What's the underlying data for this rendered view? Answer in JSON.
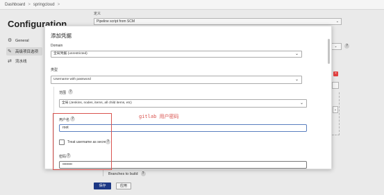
{
  "breadcrumb": {
    "items": [
      "Dashboard",
      "springcloud"
    ],
    "separator": ">"
  },
  "background": {
    "title": "Configuration",
    "sidebar": [
      {
        "label": "General",
        "icon": "gear-icon",
        "glyph": "⚙"
      },
      {
        "label": "高级项目选项",
        "icon": "wrench-icon",
        "glyph": "🔧"
      },
      {
        "label": "流水线",
        "icon": "pipeline-icon",
        "glyph": "⇄"
      }
    ],
    "definition_label": "定义",
    "definition_value": "Pipeline script from SCM",
    "branches_label": "Branches to build",
    "save_label": "保存",
    "apply_label": "应用"
  },
  "modal": {
    "title": "添加凭据",
    "domain_label": "Domain",
    "domain_value": "全局凭据 (unrestricted)",
    "kind_label": "类型",
    "kind_value": "Username with password",
    "scope_label": "范围",
    "scope_value": "全局 (Jenkins, nodes, items, all child items, etc)",
    "username_label": "用户名",
    "username_value": "root",
    "treat_secret_label": "Treat username as secret",
    "password_label": "密码",
    "password_value": "••••••••"
  },
  "annotation": {
    "text": "gitlab 用户密码",
    "color": "#d9534f"
  },
  "colors": {
    "primary_button": "#1e3a8a",
    "annotation_red": "#d9534f",
    "focus_border": "#5a7fbf"
  }
}
